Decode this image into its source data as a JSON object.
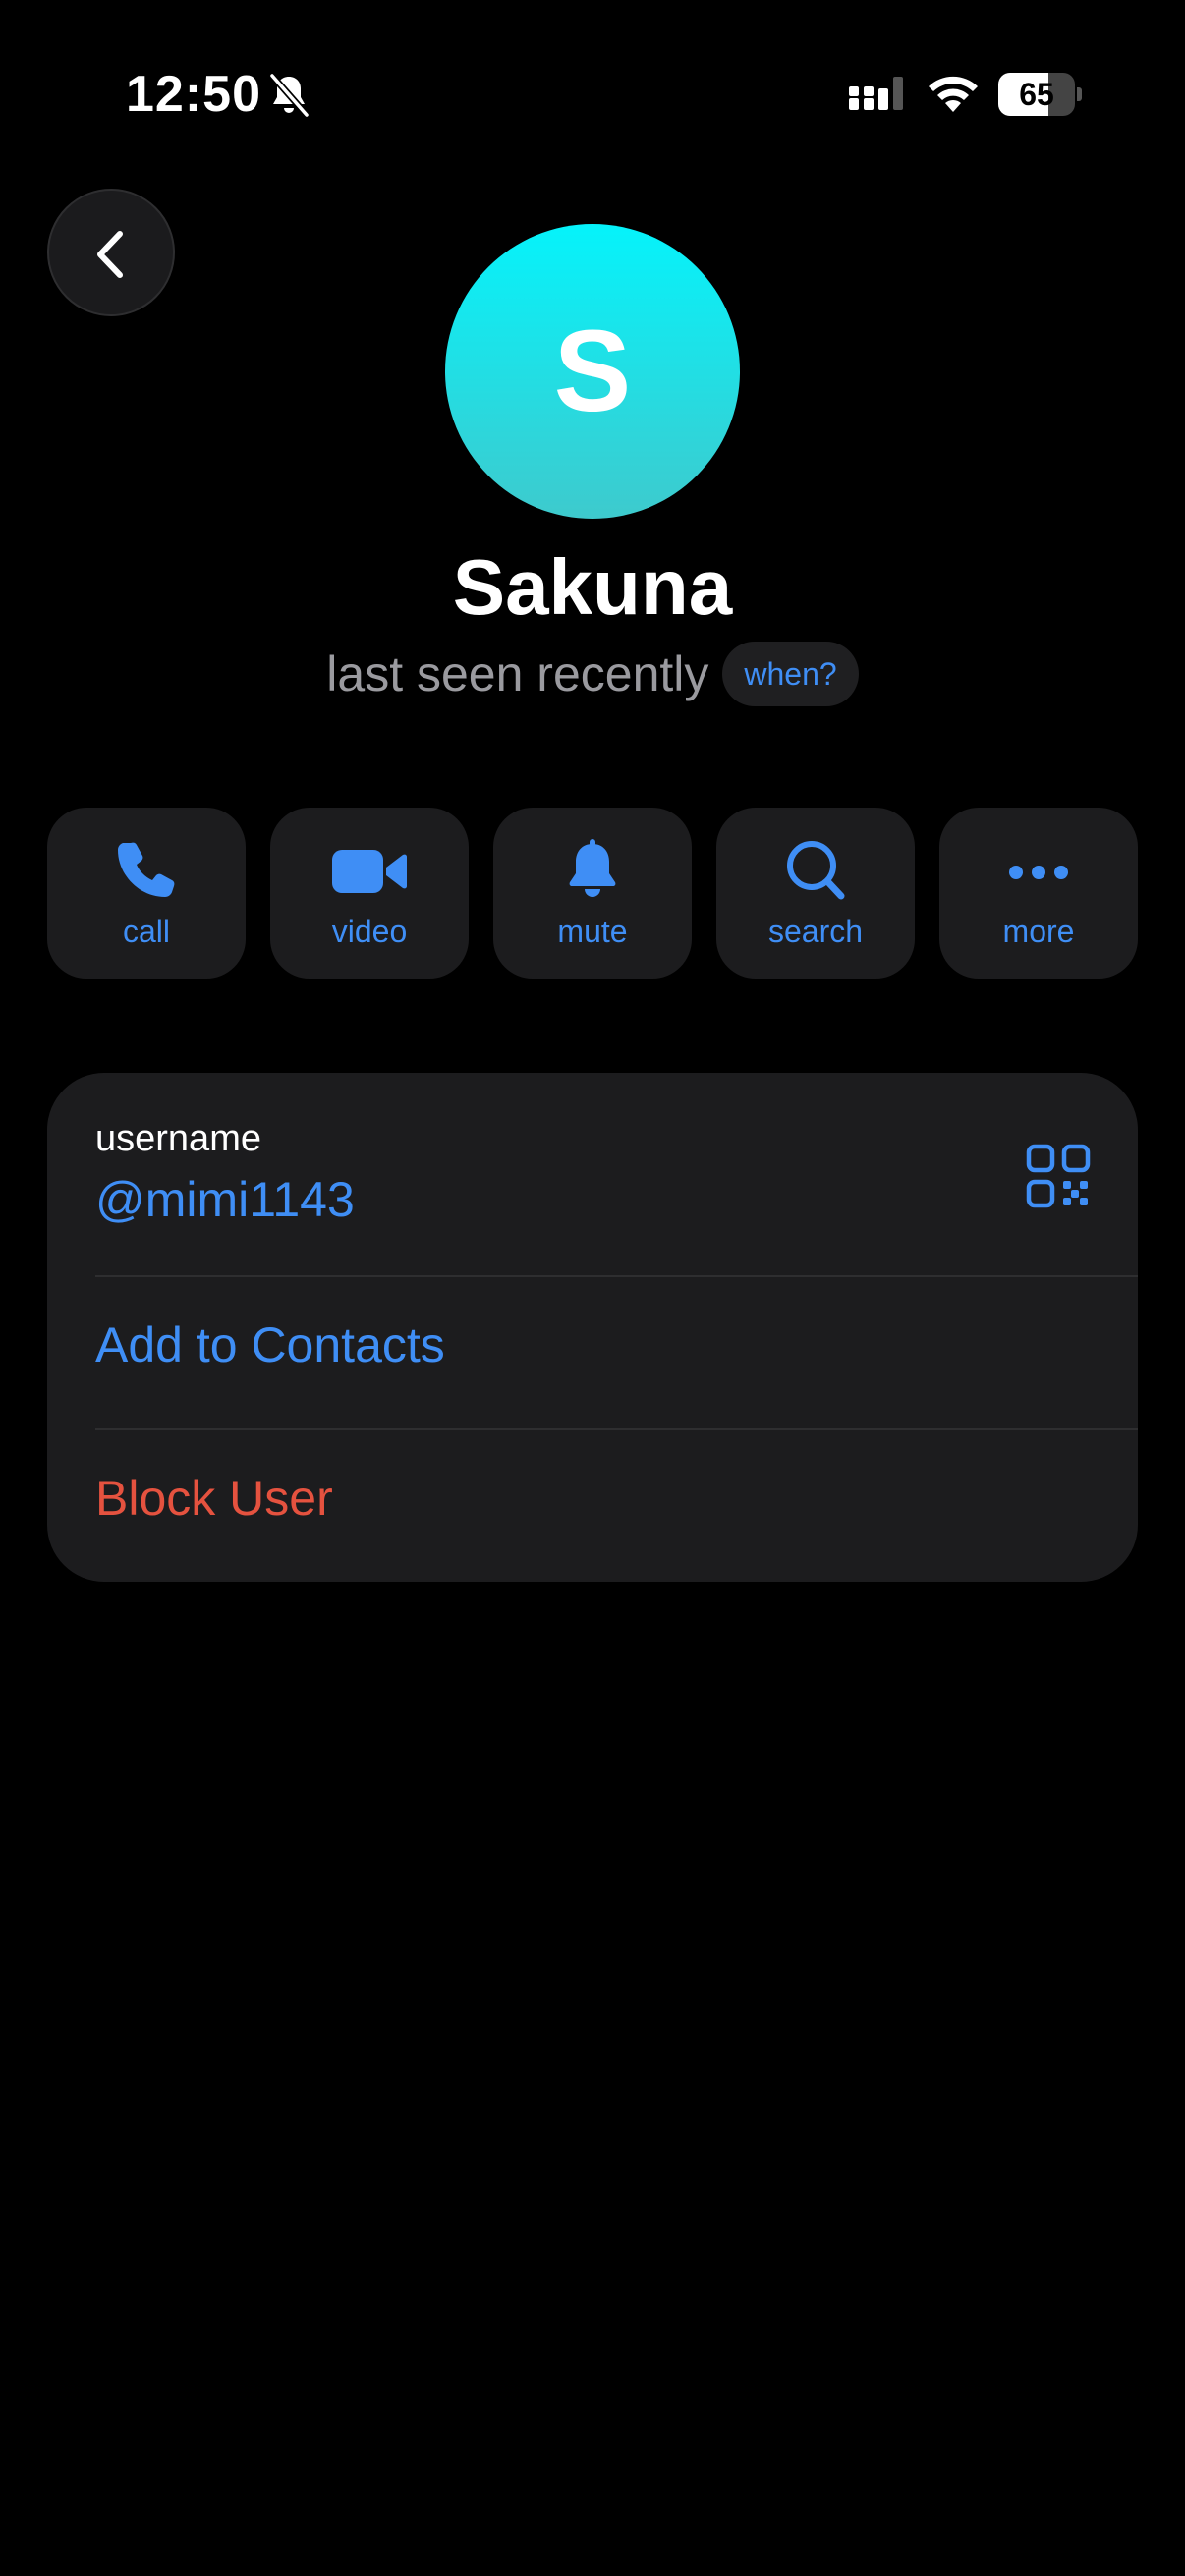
{
  "status_bar": {
    "time": "12:50",
    "battery_percent": "65",
    "battery_level": 0.65,
    "icons": [
      "bell-slash-icon",
      "cellular-signal-icon",
      "wifi-icon",
      "battery-icon"
    ]
  },
  "header": {
    "back_icon": "chevron-left-icon"
  },
  "profile": {
    "avatar_letter": "S",
    "name": "Sakuna",
    "status": "last seen recently",
    "when_label": "when?"
  },
  "actions": [
    {
      "label": "call",
      "icon": "phone-icon"
    },
    {
      "label": "video",
      "icon": "video-camera-icon"
    },
    {
      "label": "mute",
      "icon": "bell-icon"
    },
    {
      "label": "search",
      "icon": "search-icon"
    },
    {
      "label": "more",
      "icon": "more-dots-icon"
    }
  ],
  "info": {
    "username_label": "username",
    "username_value": "@mimi1143",
    "qr_icon": "qr-code-icon",
    "add_contacts_label": "Add to Contacts",
    "block_user_label": "Block User"
  },
  "colors": {
    "accent": "#3f8ef5",
    "danger": "#e5523f",
    "avatar_top": "#05f3fb",
    "avatar_bottom": "#3ecacd",
    "background": "#000000",
    "card": "#1c1c1e"
  }
}
